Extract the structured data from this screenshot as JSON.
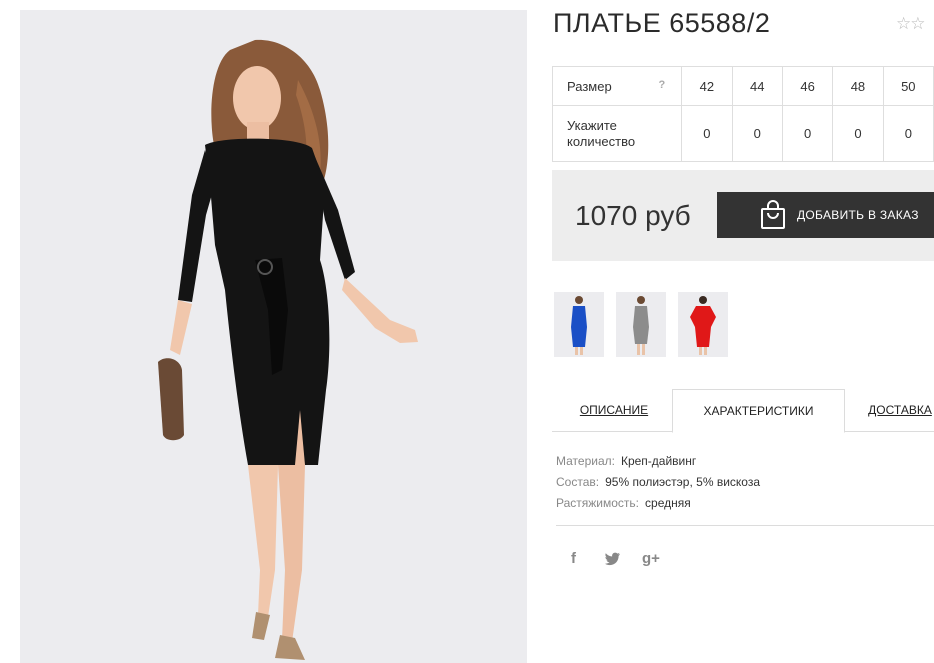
{
  "product": {
    "title": "ПЛАТЬЕ 65588/2",
    "stars": "☆☆"
  },
  "size_table": {
    "size_label": "Размер",
    "help_icon": "?",
    "sizes": [
      "42",
      "44",
      "46",
      "48",
      "50"
    ],
    "quantity_label_line1": "Укажите",
    "quantity_label_line2": "количество",
    "quantities": [
      "0",
      "0",
      "0",
      "0",
      "0"
    ]
  },
  "purchase": {
    "price": "1070 руб",
    "add_to_order": "ДОБАВИТЬ В ЗАКАЗ"
  },
  "thumbnails": [
    {
      "name": "thumb-blue-dress",
      "color": "#1a4fc6"
    },
    {
      "name": "thumb-grey-dress",
      "color": "#8c8c8c"
    },
    {
      "name": "thumb-red-dress",
      "color": "#e01818"
    }
  ],
  "tabs": {
    "description": "ОПИСАНИЕ",
    "characteristics": "ХАРАКТЕРИСТИКИ",
    "delivery": "ДОСТАВКА"
  },
  "specs": {
    "material_key": "Материал:",
    "material_val": "Креп-дайвинг",
    "composition_key": "Состав:",
    "composition_val": "95% полиэстэр, 5% вискоза",
    "stretch_key": "Растяжимость:",
    "stretch_val": "средняя"
  },
  "social": {
    "facebook": "f",
    "twitter": "🐦",
    "googleplus": "g+"
  },
  "colors": {
    "dress_main": "#141414",
    "button_bg": "#333333",
    "price_box_bg": "#ededed"
  }
}
